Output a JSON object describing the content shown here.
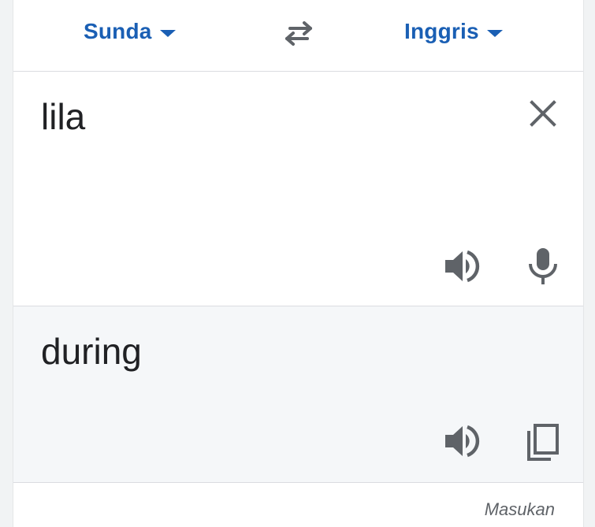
{
  "language_bar": {
    "source_language": "Sunda",
    "target_language": "Inggris",
    "swap_icon": "swap-horizontal-icon",
    "accent_color": "#1a5fb4"
  },
  "input": {
    "text": "lila",
    "clear_icon": "close-icon",
    "speak_icon": "volume-icon",
    "mic_icon": "microphone-icon"
  },
  "output": {
    "text": "during",
    "speak_icon": "volume-icon",
    "copy_icon": "copy-icon"
  },
  "footer": {
    "link_text": "Masukan"
  }
}
